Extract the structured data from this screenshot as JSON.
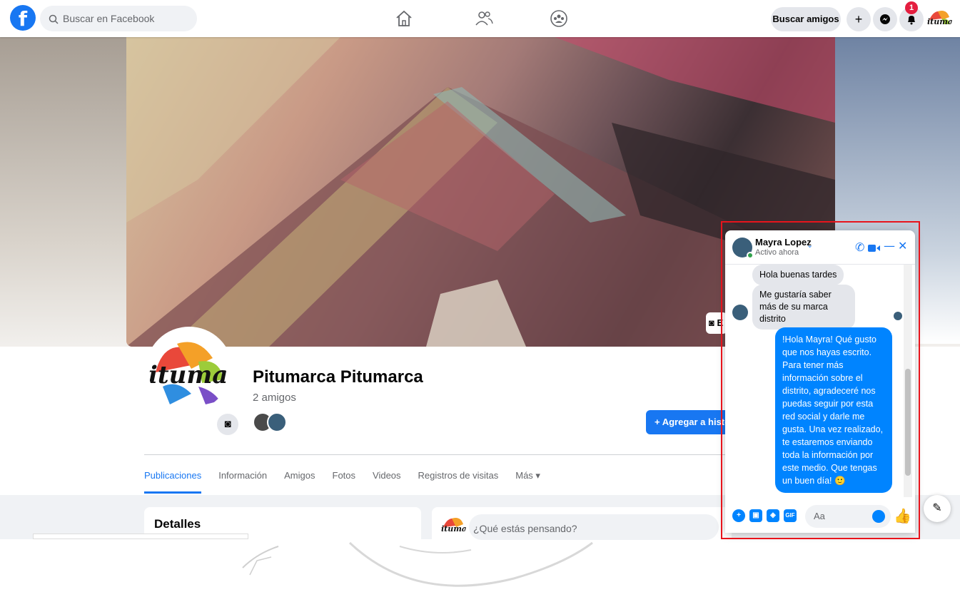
{
  "topbar": {
    "logo": "f",
    "search_placeholder": "Buscar en Facebook",
    "find_friends_label": "Buscar amigos",
    "notifications_badge": "1",
    "nav_icons": [
      "home-icon",
      "friends-icon",
      "groups-icon"
    ],
    "action_icons": [
      "plus-icon",
      "messenger-icon",
      "bell-icon"
    ]
  },
  "cover": {
    "edit_label": "E"
  },
  "profile": {
    "name": "Pitumarca Pitumarca",
    "friends_count": "2 amigos",
    "add_story_label": "+ Agregar a histor"
  },
  "tabs": [
    {
      "label": "Publicaciones",
      "active": true
    },
    {
      "label": "Información"
    },
    {
      "label": "Amigos"
    },
    {
      "label": "Fotos"
    },
    {
      "label": "Videos"
    },
    {
      "label": "Registros de visitas"
    },
    {
      "label": "Más ▾"
    }
  ],
  "details": {
    "title": "Detalles"
  },
  "composer": {
    "placeholder": "¿Qué estás pensando?"
  },
  "chat": {
    "contact_name": "Mayra Lopez",
    "status": "Activo ahora",
    "messages_in": [
      "Hola buenas tardes",
      "Me gustaría saber más de su marca distrito"
    ],
    "message_out": "!Hola Mayra! Qué gusto que nos hayas escrito. Para tener más información sobre el distrito, agradeceré nos puedas seguir por esta red social y darle me gusta. Una vez realizado, te estaremos enviando toda la información por este medio. Que tengas un buen día! 🙂",
    "input_placeholder": "Aa",
    "footer_gif_label": "GIF"
  },
  "colors": {
    "brand": "#1877f2",
    "messenger_bubble": "#0084ff",
    "highlight_box": "#e8141c",
    "online": "#31a24c",
    "badge": "#e41e3f"
  }
}
